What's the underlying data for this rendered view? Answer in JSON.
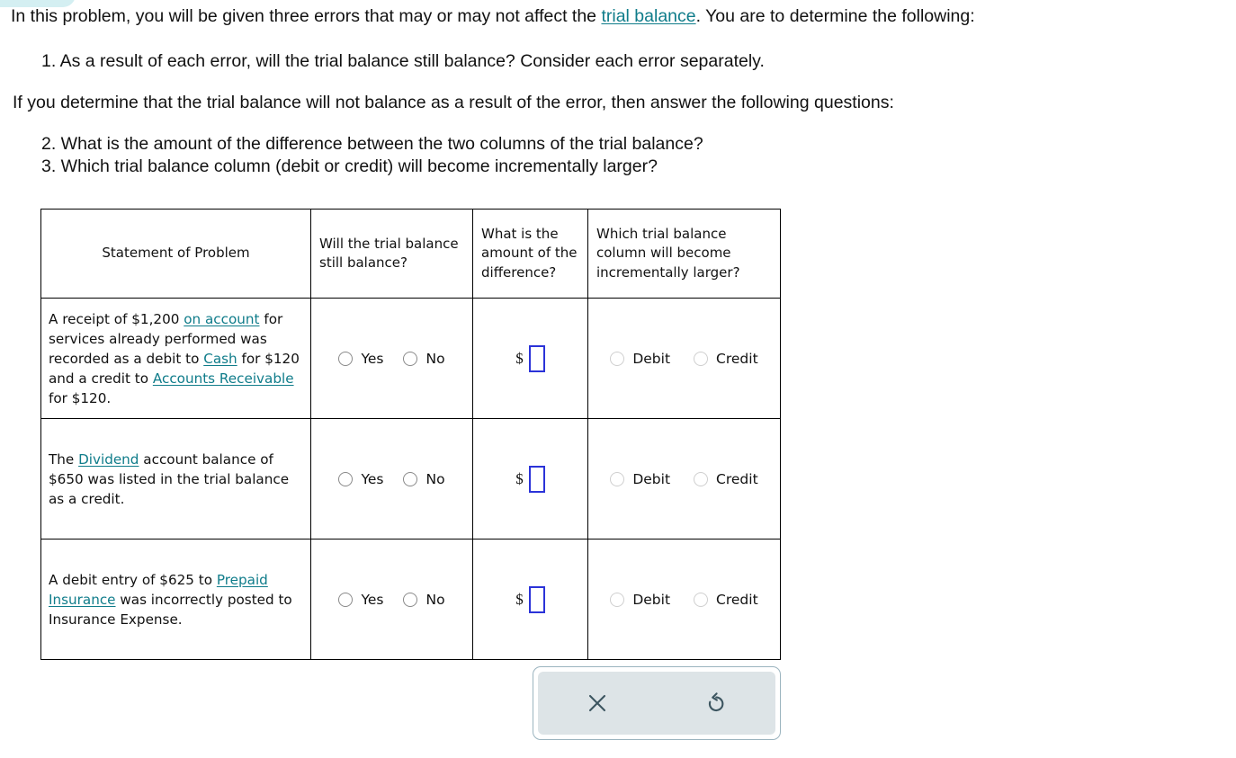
{
  "prompt": {
    "line1_pre": "In this problem, you will be given three errors that may or may not affect the ",
    "line1_link": "trial balance",
    "line1_post": ". You are to determine the following:",
    "item1": "1. As a result of each error, will the trial balance still balance? Consider each error separately.",
    "line2": "If you determine that the trial balance will not balance as a result of the error, then answer the following questions:",
    "item2": "2. What is the amount of the difference between the two columns of the trial balance?",
    "item3": "3. Which trial balance column (debit or credit) will become incrementally larger?"
  },
  "table": {
    "headers": {
      "statement": "Statement of Problem",
      "will_balance": "Will the trial balance still balance?",
      "amount": "What is the amount of the difference?",
      "which_column": "Which trial balance column will become incrementally larger?"
    },
    "options": {
      "yes": "Yes",
      "no": "No",
      "debit": "Debit",
      "credit": "Credit",
      "currency_symbol": "$",
      "amount_value": "",
      "amount_placeholder": ""
    },
    "rows": [
      {
        "statement_parts": [
          {
            "text": "A receipt of $1,200 ",
            "link": false
          },
          {
            "text": "on account",
            "link": true
          },
          {
            "text": " for services already performed was recorded as a debit to ",
            "link": false
          },
          {
            "text": "Cash",
            "link": true
          },
          {
            "text": " for $120 and a credit to ",
            "link": false
          },
          {
            "text": "Accounts Receivable",
            "link": true
          },
          {
            "text": " for $120.",
            "link": false
          }
        ]
      },
      {
        "statement_parts": [
          {
            "text": "The ",
            "link": false
          },
          {
            "text": "Dividend",
            "link": true
          },
          {
            "text": " account balance of $650 was listed in the trial balance as a credit.",
            "link": false
          }
        ]
      },
      {
        "statement_parts": [
          {
            "text": "A debit entry of $625 to ",
            "link": false
          },
          {
            "text": "Prepaid Insurance",
            "link": true
          },
          {
            "text": " was incorrectly posted to Insurance Expense.",
            "link": false
          }
        ]
      }
    ]
  },
  "toolbar": {
    "clear_label": "Clear",
    "reset_label": "Reset",
    "clear_icon": "close-x-icon",
    "reset_icon": "undo-rotate-left-icon"
  },
  "colors": {
    "link": "#0f7c8a",
    "input_border": "#2b33d8",
    "toolbar_panel": "#dde4e7",
    "toolbar_border": "#9bb4bf",
    "tab_accent": "#d4eff2",
    "icon": "#3c5560"
  }
}
